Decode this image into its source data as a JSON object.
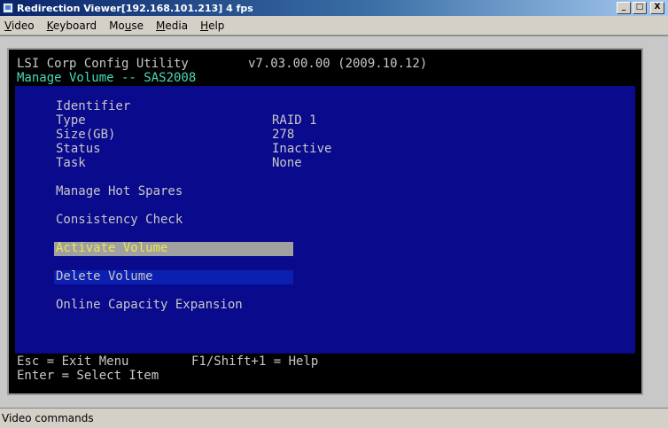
{
  "window": {
    "title": "Redirection Viewer[192.168.101.213]  4 fps",
    "controls": {
      "minimize": "_",
      "maximize": "□",
      "close": "X"
    }
  },
  "menubar": {
    "items": [
      {
        "pre": "",
        "u": "V",
        "post": "ideo"
      },
      {
        "pre": "",
        "u": "K",
        "post": "eyboard"
      },
      {
        "pre": "Mo",
        "u": "u",
        "post": "se"
      },
      {
        "pre": "",
        "u": "M",
        "post": "edia"
      },
      {
        "pre": "",
        "u": "H",
        "post": "elp"
      }
    ]
  },
  "console": {
    "header_left": "LSI Corp Config Utility",
    "header_version": "v7.03.00.00 (2009.10.12)",
    "subheader": "Manage Volume -- SAS2008",
    "fields": [
      {
        "label": "Identifier",
        "value": ""
      },
      {
        "label": "Type",
        "value": "RAID 1"
      },
      {
        "label": "Size(GB)",
        "value": "278"
      },
      {
        "label": "Status",
        "value": "Inactive"
      },
      {
        "label": "Task",
        "value": "None"
      }
    ],
    "menu": [
      {
        "label": "Manage Hot Spares"
      },
      {
        "label": "Consistency Check"
      },
      {
        "label": "Activate Volume"
      },
      {
        "label": "Delete Volume"
      },
      {
        "label": "Online Capacity Expansion"
      }
    ],
    "footer": {
      "line1_left": "Esc = Exit Menu",
      "line1_right": "F1/Shift+1 = Help",
      "line2_left": "Enter = Select Item"
    }
  },
  "statusbar": {
    "text": "Video commands"
  },
  "colors": {
    "console_bg": "#000000",
    "panel_blue": "#0a0a8c",
    "text_gray": "#c8c8c8",
    "text_cyan": "#48d8b8",
    "text_yellow": "#e8e850",
    "highlight_gray": "#a0a0a0",
    "highlight_blue": "#0b1fb0"
  }
}
